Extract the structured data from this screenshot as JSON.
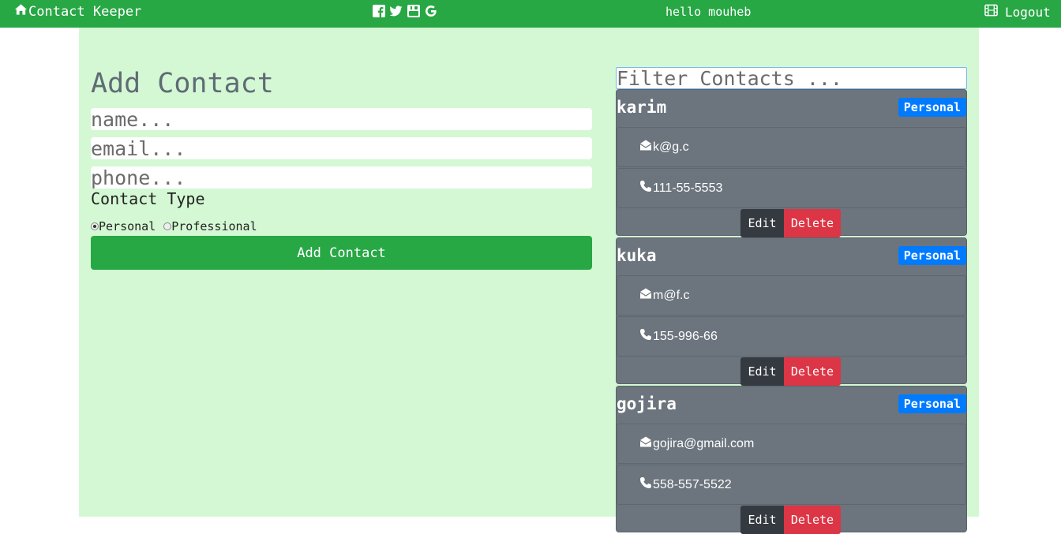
{
  "navbar": {
    "brand": "Contact Keeper",
    "brand_icon": "home-icon",
    "social_icons": [
      "facebook-icon",
      "twitter-icon",
      "youtube-icon",
      "google-icon"
    ],
    "greeting": "hello mouheb",
    "logout_label": "Logout",
    "logout_icon": "film-icon",
    "color": "#28a745"
  },
  "form": {
    "title": "Add Contact",
    "name_placeholder": "name...",
    "email_placeholder": "email...",
    "phone_placeholder": "phone...",
    "type_label": "Contact Type",
    "type_options": [
      {
        "label": "Personal",
        "checked": true
      },
      {
        "label": "Professional",
        "checked": false
      }
    ],
    "submit_label": "Add Contact"
  },
  "filter": {
    "placeholder": "Filter Contacts ..."
  },
  "contacts": [
    {
      "name": "karim",
      "type": "Personal",
      "email": "k@g.c",
      "phone": "111-55-5553"
    },
    {
      "name": "kuka",
      "type": "Personal",
      "email": "m@f.c",
      "phone": "155-996-66"
    },
    {
      "name": "gojira",
      "type": "Personal",
      "email": "gojira@gmail.com",
      "phone": "558-557-5522"
    }
  ],
  "card_buttons": {
    "edit": "Edit",
    "delete": "Delete"
  },
  "colors": {
    "page_bg": "#d4f8d4",
    "card_bg": "#6c757d",
    "badge": "#007bff",
    "delete": "#dc3545",
    "edit": "#343a40"
  }
}
